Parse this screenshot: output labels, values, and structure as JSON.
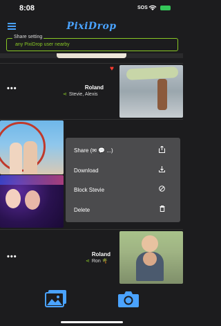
{
  "status": {
    "time": "8:08",
    "sos": "SOS",
    "battery": ""
  },
  "header": {
    "title": "PixiDrop"
  },
  "share_setting": {
    "label": "Share setting",
    "value": "any PixiDrop user nearby"
  },
  "rows": [
    {
      "sender": "Roland",
      "recipients": "Stevie, Alexis",
      "more": "•••"
    },
    {
      "sender": "Roland",
      "recipients": "Ron 🌴",
      "more": "•••"
    }
  ],
  "context_menu": {
    "items": [
      {
        "label": "Share (✉ 💬 ...)",
        "icon": "share-icon"
      },
      {
        "label": "Download",
        "icon": "download-icon"
      },
      {
        "label": "Block Stevie",
        "icon": "block-icon"
      },
      {
        "label": "Delete",
        "icon": "trash-icon"
      }
    ]
  },
  "colors": {
    "accent": "#4aa3ff",
    "share_green": "#8ac926",
    "heart": "#ff3b30",
    "menu_bg": "#4b4b4d"
  }
}
